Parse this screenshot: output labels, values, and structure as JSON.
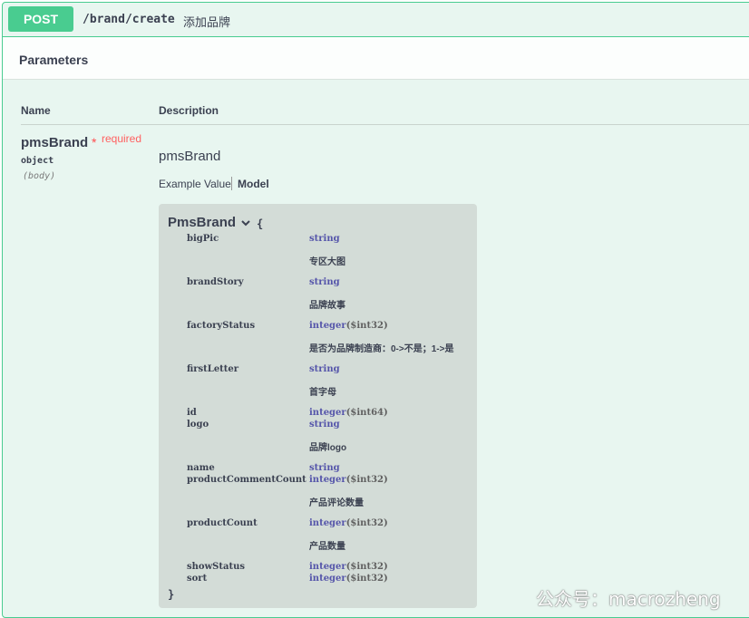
{
  "operation": {
    "method": "POST",
    "path": "/brand/create",
    "summary": "添加品牌"
  },
  "parameters": {
    "title": "Parameters",
    "col_name": "Name",
    "col_description": "Description",
    "param": {
      "name": "pmsBrand",
      "required_star": "*",
      "required_label": "required",
      "type": "object",
      "in": "(body)",
      "description": "pmsBrand"
    },
    "tabs": {
      "example": "Example Value",
      "model": "Model"
    }
  },
  "model": {
    "name": "PmsBrand",
    "brace_open": "{",
    "brace_close": "}",
    "properties": [
      {
        "name": "bigPic",
        "type": "string",
        "format": "",
        "description": "专区大图"
      },
      {
        "name": "brandStory",
        "type": "string",
        "format": "",
        "description": "品牌故事"
      },
      {
        "name": "factoryStatus",
        "type": "integer",
        "format": "($int32)",
        "description": "是否为品牌制造商：0->不是；1->是"
      },
      {
        "name": "firstLetter",
        "type": "string",
        "format": "",
        "description": "首字母"
      },
      {
        "name": "id",
        "type": "integer",
        "format": "($int64)",
        "description": ""
      },
      {
        "name": "logo",
        "type": "string",
        "format": "",
        "description": "品牌logo"
      },
      {
        "name": "name",
        "type": "string",
        "format": "",
        "description": ""
      },
      {
        "name": "productCommentCount",
        "type": "integer",
        "format": "($int32)",
        "description": "产品评论数量"
      },
      {
        "name": "productCount",
        "type": "integer",
        "format": "($int32)",
        "description": "产品数量"
      },
      {
        "name": "showStatus",
        "type": "integer",
        "format": "($int32)",
        "description": ""
      },
      {
        "name": "sort",
        "type": "integer",
        "format": "($int32)",
        "description": ""
      }
    ]
  },
  "watermark": "公众号：macrozheng",
  "colors": {
    "post": "#49cc90",
    "background": "#e8f6f0",
    "required": "#ff6060",
    "type": "#5555aa"
  }
}
